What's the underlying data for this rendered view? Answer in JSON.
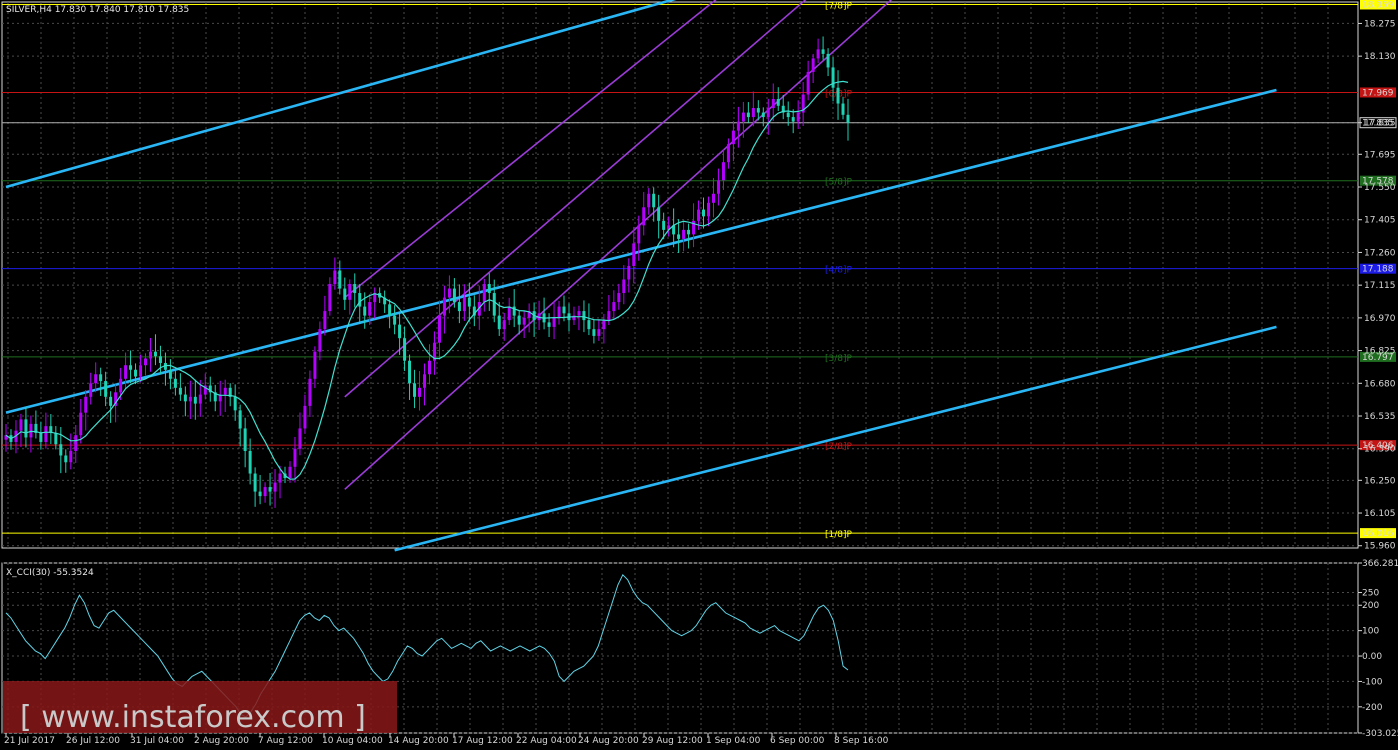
{
  "main_panel": {
    "title": "SILVER,H4  17.830 17.840 17.810 17.835"
  },
  "indicator_panel": {
    "title": "X_CCI(30) -55.3524"
  },
  "watermark": {
    "text": "[ www.instaforex.com ]"
  },
  "colors": {
    "background": "#000000",
    "grid": "#4a4a4a",
    "bull_candle": "#b400ff",
    "bear_candle": "#1ed2b4",
    "ma_line": "#40e0d0",
    "regression_channel": "#9b3bd8",
    "trend_lines": "#2ab6f5",
    "murrey_red": "#c41414",
    "murrey_green": "#1f6e1f",
    "murrey_blue": "#1c1ce6",
    "murrey_yellow": "#ffff00",
    "current_price_line": "#b0b0b0",
    "cci_line": "#5fd3e6",
    "watermark_bg": "#8a1818"
  },
  "chart_data": [
    {
      "type": "candlestick",
      "symbol": "SILVER",
      "timeframe": "H4",
      "ohlc_last": {
        "open": 17.83,
        "high": 17.84,
        "low": 17.81,
        "close": 17.835
      },
      "ylim": [
        15.95,
        18.37
      ],
      "y_ticks": [
        "18.275",
        "18.130",
        "17.835",
        "17.695",
        "17.550",
        "17.405",
        "17.260",
        "17.115",
        "16.970",
        "16.825",
        "16.680",
        "16.535",
        "16.390",
        "16.250",
        "16.105",
        "15.960"
      ],
      "x_tick_labels": [
        "21 Jul 2017",
        "26 Jul 12:00",
        "31 Jul 04:00",
        "2 Aug 20:00",
        "7 Aug 12:00",
        "10 Aug 04:00",
        "14 Aug 20:00",
        "17 Aug 12:00",
        "22 Aug 04:00",
        "24 Aug 20:00",
        "29 Aug 12:00",
        "1 Sep 04:00",
        "6 Sep 00:00",
        "8 Sep 16:00"
      ],
      "closes": [
        16.45,
        16.42,
        16.47,
        16.52,
        16.44,
        16.5,
        16.46,
        16.42,
        16.49,
        16.46,
        16.41,
        16.36,
        16.33,
        16.38,
        16.45,
        16.55,
        16.62,
        16.68,
        16.72,
        16.69,
        16.62,
        16.58,
        16.64,
        16.7,
        16.76,
        16.74,
        16.71,
        16.76,
        16.79,
        16.82,
        16.8,
        16.77,
        16.74,
        16.7,
        16.66,
        16.63,
        16.6,
        16.62,
        16.59,
        16.63,
        16.67,
        16.64,
        16.6,
        16.63,
        16.66,
        16.62,
        16.56,
        16.48,
        16.38,
        16.28,
        16.2,
        16.18,
        16.22,
        16.2,
        16.24,
        16.28,
        16.26,
        16.31,
        16.39,
        16.48,
        16.58,
        16.7,
        16.82,
        16.92,
        17.0,
        17.12,
        17.18,
        17.1,
        17.05,
        17.12,
        17.08,
        17.02,
        16.98,
        17.04,
        17.08,
        17.06,
        17.03,
        16.98,
        16.94,
        16.88,
        16.78,
        16.68,
        16.62,
        16.66,
        16.72,
        16.78,
        16.86,
        16.98,
        17.06,
        17.1,
        17.04,
        17.0,
        17.06,
        17.02,
        16.98,
        17.04,
        17.12,
        17.08,
        16.98,
        16.92,
        16.96,
        17.02,
        16.98,
        16.94,
        16.97,
        17.0,
        16.96,
        16.99,
        16.95,
        16.93,
        16.97,
        17.02,
        16.99,
        16.96,
        16.98,
        17.0,
        16.96,
        16.92,
        16.89,
        16.92,
        16.96,
        17.0,
        17.04,
        17.08,
        17.14,
        17.2,
        17.3,
        17.38,
        17.46,
        17.52,
        17.46,
        17.4,
        17.36,
        17.38,
        17.34,
        17.32,
        17.36,
        17.34,
        17.4,
        17.45,
        17.42,
        17.48,
        17.52,
        17.58,
        17.66,
        17.74,
        17.8,
        17.84,
        17.88,
        17.86,
        17.9,
        17.88,
        17.86,
        17.9,
        17.94,
        17.91,
        17.88,
        17.86,
        17.84,
        17.88,
        17.96,
        18.06,
        18.12,
        18.16,
        18.14,
        18.08,
        17.99,
        17.92,
        17.87,
        17.835
      ],
      "sma_period_label": "moving average"
    },
    {
      "type": "line",
      "name": "X_CCI(30)",
      "last_value": -55.3524,
      "ylim": [
        -303.025,
        366.2811
      ],
      "y_ticks": [
        "366.2811",
        "250",
        "200",
        "100",
        "0.00",
        "-100",
        "-200",
        "-303.025"
      ],
      "values": [
        170,
        150,
        120,
        90,
        60,
        40,
        20,
        10,
        -10,
        20,
        50,
        80,
        110,
        150,
        200,
        240,
        210,
        160,
        120,
        110,
        140,
        170,
        180,
        160,
        140,
        120,
        100,
        80,
        60,
        40,
        20,
        0,
        -30,
        -60,
        -90,
        -110,
        -120,
        -100,
        -80,
        -70,
        -60,
        -80,
        -100,
        -120,
        -140,
        -160,
        -180,
        -200,
        -230,
        -240,
        -220,
        -190,
        -150,
        -120,
        -90,
        -60,
        -20,
        20,
        60,
        100,
        140,
        160,
        170,
        150,
        140,
        160,
        150,
        120,
        100,
        110,
        90,
        70,
        40,
        10,
        -30,
        -60,
        -80,
        -100,
        -90,
        -60,
        -20,
        10,
        40,
        30,
        10,
        0,
        20,
        40,
        60,
        70,
        50,
        30,
        40,
        50,
        40,
        30,
        50,
        60,
        40,
        20,
        30,
        40,
        30,
        20,
        30,
        40,
        30,
        20,
        30,
        40,
        30,
        10,
        -20,
        -80,
        -100,
        -80,
        -60,
        -50,
        -40,
        -20,
        0,
        40,
        100,
        160,
        220,
        280,
        320,
        300,
        260,
        230,
        210,
        200,
        180,
        160,
        140,
        120,
        100,
        90,
        80,
        90,
        100,
        120,
        150,
        180,
        200,
        210,
        190,
        170,
        160,
        150,
        140,
        130,
        110,
        100,
        90,
        100,
        110,
        120,
        100,
        90,
        80,
        70,
        60,
        80,
        120,
        160,
        190,
        200,
        180,
        140,
        60,
        -40,
        -55
      ]
    }
  ],
  "murrey_levels": [
    {
      "label": "[7/8]P",
      "price": "18.359",
      "color": "yellow"
    },
    {
      "label": "[6/8]P",
      "price": "17.969",
      "color": "red"
    },
    {
      "label": "[5/8]P",
      "price": "17.578",
      "color": "green"
    },
    {
      "label": "[4/8]P",
      "price": "17.188",
      "color": "blue"
    },
    {
      "label": "[3/8]P",
      "price": "16.797",
      "color": "green"
    },
    {
      "label": "[2/8]P",
      "price": "16.406",
      "color": "red"
    },
    {
      "label": "[1/8]P",
      "price": "16.016",
      "color": "yellow"
    }
  ],
  "current_price_label": "17.835"
}
